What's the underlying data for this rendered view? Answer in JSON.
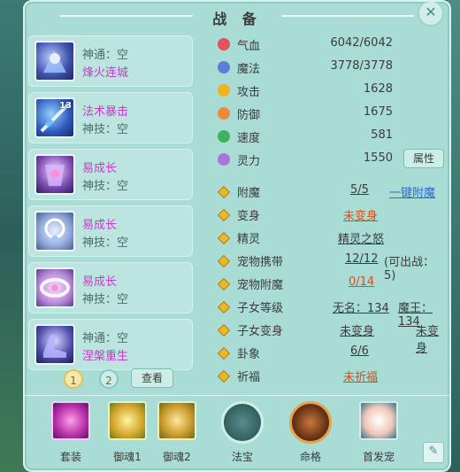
{
  "title": "战 备",
  "equipment": [
    {
      "line1": "神通：空",
      "line2": "烽火连城",
      "badge": ""
    },
    {
      "line1": "法术暴击",
      "line2": "神技：空",
      "badge": "13"
    },
    {
      "line1": "易成长",
      "line2": "神技：空",
      "badge": ""
    },
    {
      "line1": "易成长",
      "line2": "神技：空",
      "badge": ""
    },
    {
      "line1": "易成长",
      "line2": "神技：空",
      "badge": ""
    },
    {
      "line1": "神通：空",
      "line2": "涅槃重生",
      "badge": ""
    }
  ],
  "pages": [
    "1",
    "2"
  ],
  "view_button": "查看",
  "stats": [
    {
      "label": "气血",
      "value": "6042/6042",
      "icon": "heart-icon"
    },
    {
      "label": "魔法",
      "value": "3778/3778",
      "icon": "magic-icon"
    },
    {
      "label": "攻击",
      "value": "1628",
      "icon": "attack-icon"
    },
    {
      "label": "防御",
      "value": "1675",
      "icon": "shield-icon"
    },
    {
      "label": "速度",
      "value": "581",
      "icon": "speed-icon"
    },
    {
      "label": "灵力",
      "value": "1550",
      "icon": "spirit-icon"
    }
  ],
  "attr_button": "属性",
  "info": {
    "enchant_label": "附魔",
    "enchant_value": "5/5",
    "enchant_link": "一键附魔",
    "transform_label": "变身",
    "transform_value": "未变身",
    "sprite_label": "精灵",
    "sprite_value": "精灵之怒",
    "pet_carry_label": "宠物携带",
    "pet_carry_value": "12/12",
    "pet_carry_note": "(可出战：5)",
    "pet_enchant_label": "宠物附魔",
    "pet_enchant_value": "0/14",
    "child_level_label": "子女等级",
    "child_level_value1": "无名：134",
    "child_level_value2": "魔王：134",
    "child_transform_label": "子女变身",
    "child_transform_value1": "未变身",
    "child_transform_value2": "未变身",
    "hexagram_label": "卦象",
    "hexagram_value": "6/6",
    "pray_label": "祈福",
    "pray_value": "未祈福"
  },
  "tabs": [
    "套装",
    "御魂1",
    "御魂2",
    "法宝",
    "命格",
    "首发宠"
  ],
  "colors": {
    "panel": "#a8dcd4",
    "purple": "#c53bc9",
    "orange": "#d2521a",
    "blue": "#2b6ad8"
  }
}
